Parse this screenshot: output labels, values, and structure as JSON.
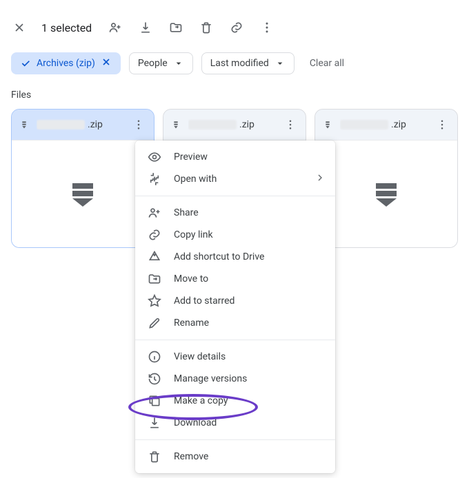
{
  "toolbar": {
    "selected_count": "1 selected"
  },
  "filters": {
    "archives_label": "Archives (zip)",
    "people_label": "People",
    "lastmod_label": "Last modified",
    "clear_all": "Clear all"
  },
  "section": {
    "files_label": "Files"
  },
  "files": [
    {
      "ext": ".zip"
    },
    {
      "ext": ".zip"
    },
    {
      "ext": ".zip"
    }
  ],
  "menu": {
    "preview": "Preview",
    "open_with": "Open with",
    "share": "Share",
    "copy_link": "Copy link",
    "add_shortcut": "Add shortcut to Drive",
    "move_to": "Move to",
    "add_starred": "Add to starred",
    "rename": "Rename",
    "view_details": "View details",
    "manage_versions": "Manage versions",
    "make_copy": "Make a copy",
    "download": "Download",
    "remove": "Remove"
  }
}
